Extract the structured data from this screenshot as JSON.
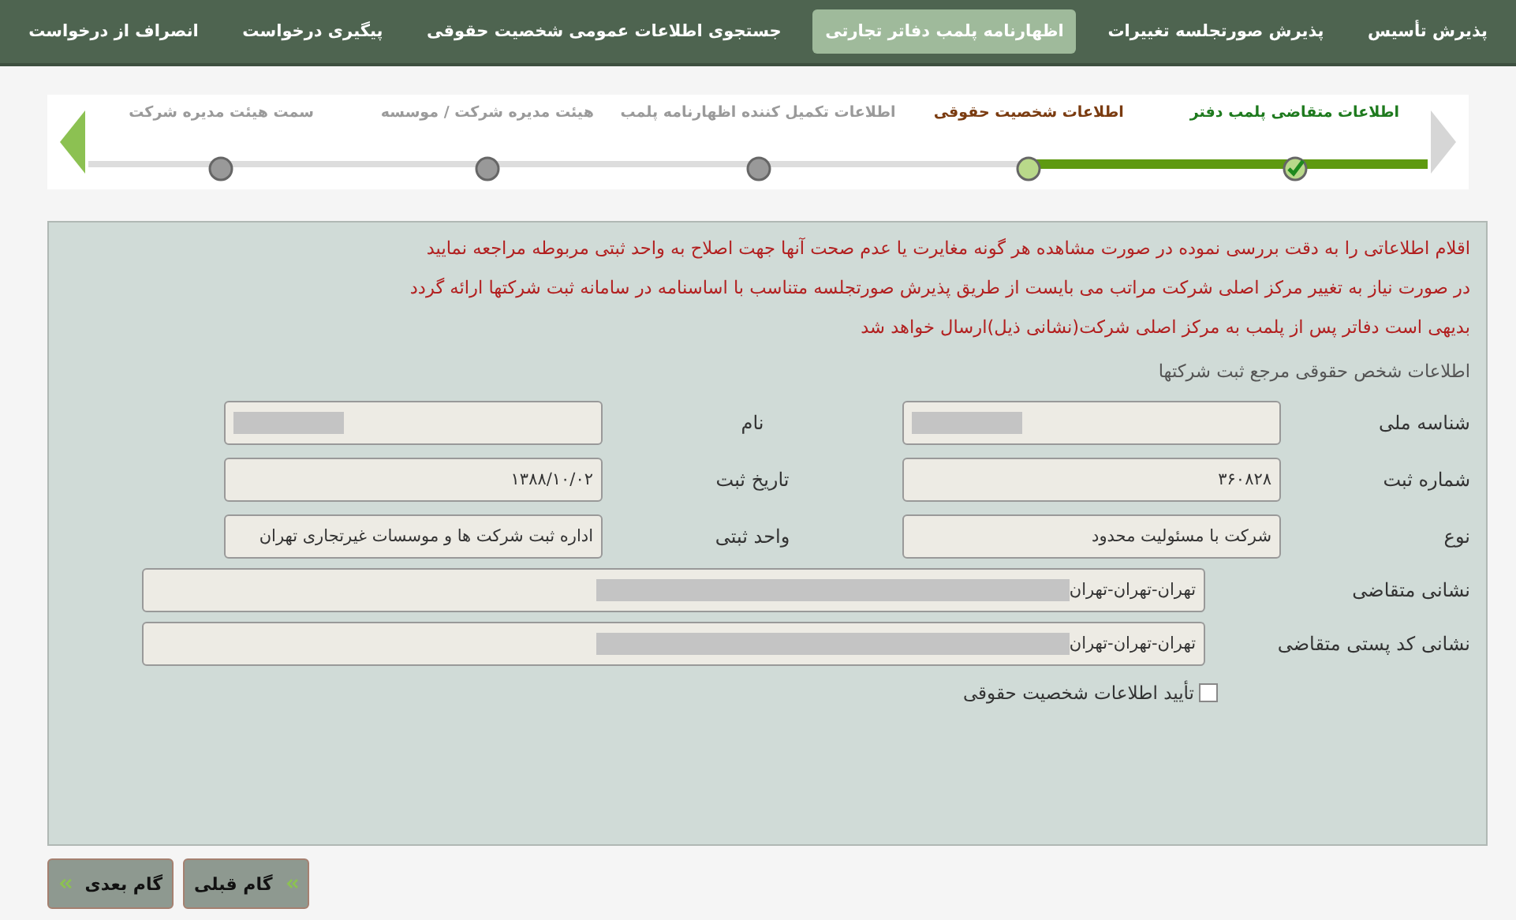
{
  "nav_tabs": [
    {
      "label": "پذیرش تأسیس",
      "selected": false
    },
    {
      "label": "پذیرش صورتجلسه تغییرات",
      "selected": false
    },
    {
      "label": "اظهارنامه پلمب دفاتر تجارتی",
      "selected": true
    },
    {
      "label": "جستجوی اطلاعات عمومی شخصیت حقوقی",
      "selected": false
    },
    {
      "label": "پیگیری درخواست",
      "selected": false
    },
    {
      "label": "انصراف از درخواست",
      "selected": false
    }
  ],
  "steps": [
    {
      "label": "اطلاعات متقاضی پلمب دفتر",
      "kind": "done"
    },
    {
      "label": "اطلاعات شخصیت حقوقی",
      "kind": "current"
    },
    {
      "label": "اطلاعات تکمیل کننده اظهارنامه پلمب",
      "kind": "pending"
    },
    {
      "label": "هیئت مدیره شرکت / موسسه",
      "kind": "pending"
    },
    {
      "label": "سمت هیئت مدیره شرکت",
      "kind": "pending"
    }
  ],
  "notices": [
    "اقلام اطلاعاتی را به دقت بررسی نموده در صورت مشاهده هر گونه مغایرت یا عدم صحت آنها جهت اصلاح به واحد ثبتی مربوطه مراجعه نمایید",
    "در صورت نیاز به تغییر مرکز اصلی شرکت مراتب می بایست از طریق پذیرش صورتجلسه متناسب با اساسنامه در سامانه ثبت شرکتها ارائه گردد",
    "بدیهی است دفاتر پس از پلمب به مرکز اصلی شرکت(نشانی ذیل)ارسال خواهد شد"
  ],
  "section_title": "اطلاعات شخص حقوقی مرجع ثبت شرکتها",
  "fields": [
    {
      "label": "شناسه ملی",
      "redacted": true,
      "kind": "short"
    },
    {
      "label": "نام",
      "redacted": true,
      "kind": "short"
    },
    {
      "label": "شماره ثبت",
      "value": "۳۶۰۸۲۸",
      "kind": "short"
    },
    {
      "label": "تاریخ ثبت",
      "value": "۱۳۸۸/۱۰/۰۲",
      "kind": "short"
    },
    {
      "label": "نوع",
      "value": "شرکت با مسئولیت محدود",
      "kind": "short"
    },
    {
      "label": "واحد ثبتی",
      "value": "اداره ثبت شرکت ها و موسسات غیرتجاری تهران",
      "kind": "short"
    },
    {
      "label": "نشانی متقاضی",
      "value": "تهران-تهران-تهران",
      "redacted": true,
      "kind": "wide"
    },
    {
      "label": "نشانی کد پستی متقاضی",
      "value": "تهران-تهران-تهران",
      "redacted": true,
      "kind": "wide"
    }
  ],
  "confirm": {
    "label": "تأیید اطلاعات شخصیت حقوقی",
    "checked": false
  },
  "buttons": [
    {
      "label": "گام قبلی"
    },
    {
      "label": "گام بعدی"
    }
  ]
}
